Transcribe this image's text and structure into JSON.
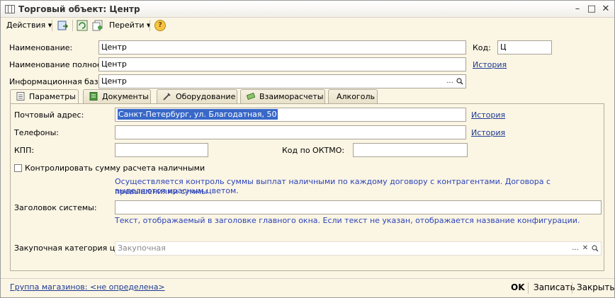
{
  "window": {
    "title": "Торговый объект: Центр",
    "minimize_icon": "minimize-icon",
    "restore_icon": "restore-icon",
    "close_icon": "close-icon"
  },
  "toolbar": {
    "actions_label": "Действия",
    "goto_label": "Перейти",
    "help_label": "?",
    "icons": [
      "save-and-close-icon",
      "reread-icon",
      "copy-icon",
      "help-icon"
    ]
  },
  "header": {
    "name_label": "Наименование:",
    "name_value": "Центр",
    "code_label": "Код:",
    "code_value": "Ц",
    "full_name_label": "Наименование полное:",
    "full_name_value": "Центр",
    "history_label": "История",
    "infobase_label": "Информационная база:",
    "infobase_value": "Центр",
    "ellipsis": "...",
    "search_icon": "magnifier-icon"
  },
  "tabs": [
    {
      "label": "Параметры",
      "icon": "params-icon",
      "active": true
    },
    {
      "label": "Документы",
      "icon": "documents-icon",
      "active": false
    },
    {
      "label": "Оборудование",
      "icon": "equipment-icon",
      "active": false
    },
    {
      "label": "Взаиморасчеты",
      "icon": "settlements-icon",
      "active": false
    },
    {
      "label": "Алкоголь",
      "icon": "",
      "active": false
    }
  ],
  "params": {
    "postal_label": "Почтовый адрес:",
    "postal_value": "Санкт-Петербург, ул. Благодатная, 50",
    "phones_label": "Телефоны:",
    "phones_value": "",
    "history_label": "История",
    "kpp_label": "КПП:",
    "kpp_value": "",
    "oktmo_label": "Код по ОКТМО:",
    "oktmo_value": "",
    "control_checkbox_label": "Контролировать сумму расчета наличными",
    "control_hint_line1": "Осуществляется контроль суммы выплат наличными по каждому договору с контрагентами. Договора с превышениями суммы",
    "control_hint_line2": "выделяются красным цветом.",
    "system_title_label": "Заголовок системы:",
    "system_title_value": "",
    "system_title_hint": "Текст, отображаемый в заголовке главного окна. Если текст не указан, отображается название конфигурации.",
    "purchase_price_label": "Закупочная категория цен:",
    "purchase_price_placeholder": "Закупочная",
    "ellipsis": "...",
    "clear_icon": "clear-icon",
    "search_icon": "magnifier-icon"
  },
  "footer": {
    "store_group_link": "Группа магазинов: <не определена>",
    "ok_label": "OK",
    "save_label": "Записать",
    "close_label": "Закрыть"
  },
  "colors": {
    "background": "#fbf5e4",
    "link": "#1c3a92",
    "hint": "#2c44b8",
    "selection": "#3868c8"
  }
}
